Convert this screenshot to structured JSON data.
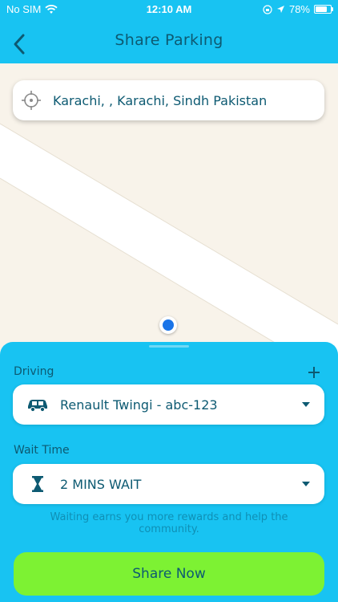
{
  "status_bar": {
    "carrier": "No SIM",
    "time": "12:10 AM",
    "battery": "78%",
    "battery_level": 0.78
  },
  "header": {
    "title": "Share Parking"
  },
  "search": {
    "address": "Karachi,  , Karachi, Sindh  Pakistan"
  },
  "icons": [
    "back-chevron-icon",
    "location-target-icon",
    "wifi-icon",
    "orientation-lock-icon",
    "navigation-arrow-icon",
    "battery-icon",
    "plus-icon",
    "car-icon",
    "hourglass-icon",
    "dropdown-caret-icon"
  ],
  "sheet": {
    "driving_label": "Driving",
    "vehicle": "Renault Twingi - abc-123",
    "wait_label": "Wait Time",
    "wait_value": "2 MINS WAIT",
    "hint": "Waiting earns you more rewards and help the community.",
    "share_button": "Share Now"
  },
  "colors": {
    "accent": "#18c3f2",
    "button": "#7df233",
    "text": "#0d5a72",
    "map_bg": "#f8f3ea",
    "location_dot": "#1a74e8"
  }
}
